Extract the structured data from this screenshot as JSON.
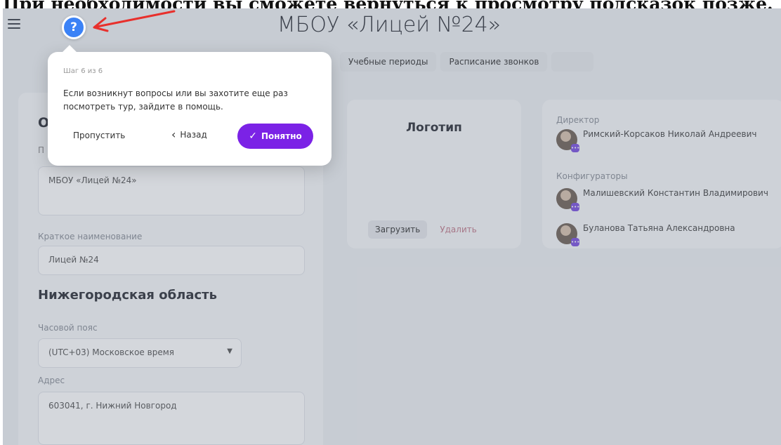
{
  "caption": "При необходимости вы сможете вернуться к просмотру подсказок позже.",
  "app": {
    "title": "МБОУ «Лицей №24»",
    "tabs": [
      "Учебные периоды",
      "Расписание звонков"
    ]
  },
  "form": {
    "section_title_clipped": "О",
    "full_name_label_clipped": "П",
    "full_name_value": "МБОУ «Лицей №24»",
    "short_name_label": "Краткое наименование",
    "short_name_value": "Лицей №24",
    "region_title": "Нижегородская область",
    "timezone_label": "Часовой пояс",
    "timezone_value": "(UTC+03) Московское время",
    "address_label": "Адрес",
    "address_value": "603041, г. Нижний Новгород"
  },
  "logo": {
    "title": "Логотип",
    "upload_label": "Загрузить",
    "delete_label": "Удалить"
  },
  "people": {
    "director_label": "Директор",
    "director_name": "Римский-Корсаков Николай Андреевич",
    "configurators_label": "Конфигураторы",
    "configurators": [
      "Малишевский Константин Владимирович",
      "Буланова Татьяна Александровна"
    ]
  },
  "tour": {
    "step": "Шаг 6 из 6",
    "text": "Если возникнут вопросы или вы захотите еще раз посмотреть тур, зайдите в помощь.",
    "skip_label": "Пропустить",
    "back_label": "Назад",
    "ok_label": "Понятно"
  },
  "icons": {
    "help": "question-circle-icon",
    "menu": "hamburger-icon",
    "arrow": "red-arrow-annotation"
  },
  "colors": {
    "accent": "#7b22e6",
    "help_button": "#3b82f6",
    "arrow": "#e8302c"
  }
}
